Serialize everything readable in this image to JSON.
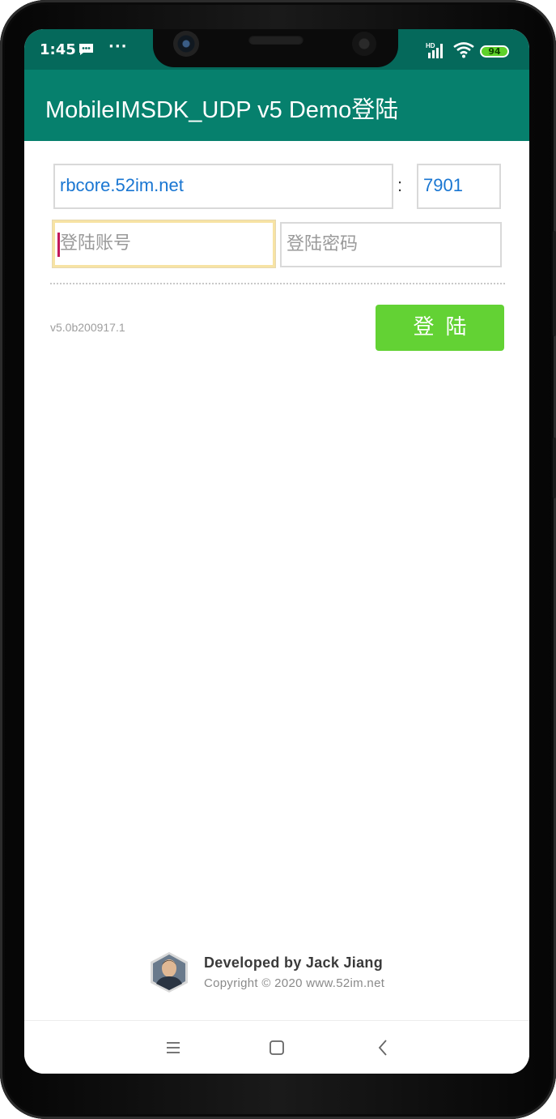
{
  "status_bar": {
    "time": "1:45",
    "more_indicator": "···",
    "network_label": "HD",
    "battery_level": "94",
    "icons": [
      "message-icon",
      "signal-icon",
      "wifi-icon",
      "battery-icon"
    ]
  },
  "app_bar": {
    "title": "MobileIMSDK_UDP v5 Demo登陆"
  },
  "form": {
    "server_host_value": "rbcore.52im.net",
    "port_separator": ":",
    "server_port_value": "7901",
    "account_placeholder": "登陆账号",
    "account_value": "",
    "password_placeholder": "登陆密码",
    "password_value": ""
  },
  "version_label": "v5.0b200917.1",
  "login_button_label": "登陆",
  "footer": {
    "developer": "Developed by Jack Jiang",
    "copyright": "Copyright © 2020 www.52im.net"
  },
  "nav_bar": {
    "icons": [
      "menu-icon",
      "home-icon",
      "back-icon"
    ]
  },
  "colors": {
    "app_bar": "#06806d",
    "status_bar": "#05695b",
    "login_button": "#63d234",
    "input_value": "#1976d2",
    "caret": "#c2185b"
  }
}
